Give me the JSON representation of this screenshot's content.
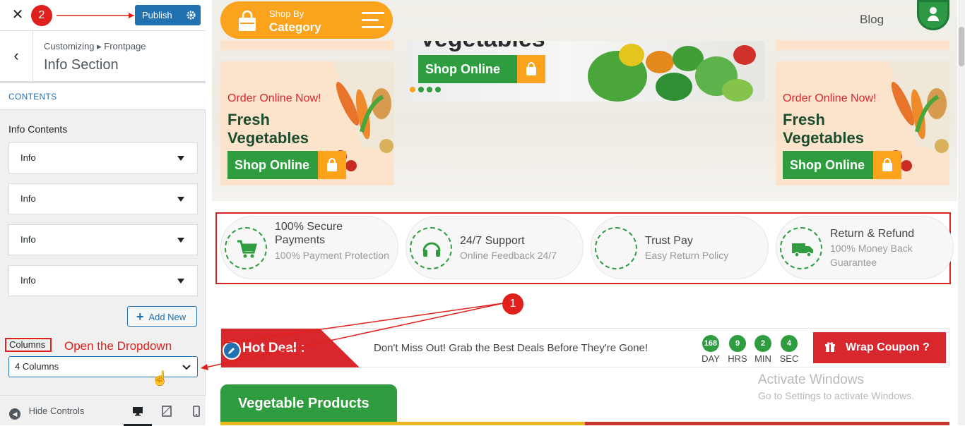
{
  "annotations": {
    "step1": "1",
    "step2": "2",
    "hint": "Open the Dropdown"
  },
  "customizer": {
    "publish_label": "Publish",
    "breadcrumb": "Customizing ▸ Frontpage",
    "section_title": "Info Section",
    "contents_heading": "CONTENTS",
    "info_contents_label": "Info Contents",
    "info_items": [
      "Info",
      "Info",
      "Info",
      "Info"
    ],
    "add_new_label": "Add New",
    "columns_label": "Columns",
    "columns_value": "4 Columns",
    "hide_controls_label": "Hide Controls"
  },
  "site": {
    "shop_by_small": "Shop By",
    "shop_by_big": "Category",
    "nav_blog": "Blog",
    "banner_title": "Vegetables",
    "promo_order": "Order Online Now!",
    "promo_title": "Fresh Vegetables",
    "shop_online": "Shop Online",
    "features": [
      {
        "title": "100% Secure Payments",
        "subtitle": "100% Payment Protection",
        "icon": "cart-icon"
      },
      {
        "title": "24/7 Support",
        "subtitle": "Online Feedback 24/7",
        "icon": "headphones-icon"
      },
      {
        "title": "Trust Pay",
        "subtitle": "Easy Return Policy",
        "icon": "blank-icon"
      },
      {
        "title": "Return & Refund",
        "subtitle": "100% Money Back Guarantee",
        "icon": "truck-icon"
      }
    ],
    "deal": {
      "label": "Hot Deal :",
      "message": "Don't Miss Out! Grab the Best Deals Before They're Gone!",
      "countdown": [
        {
          "value": "168",
          "unit": "DAY"
        },
        {
          "value": "9",
          "unit": "HRS"
        },
        {
          "value": "2",
          "unit": "MIN"
        },
        {
          "value": "4",
          "unit": "SEC"
        }
      ],
      "coupon_label": "Wrap Coupon ?"
    },
    "products_tab": "Vegetable Products"
  },
  "watermark": {
    "line1": "Activate Windows",
    "line2": "Go to Settings to activate Windows."
  },
  "colors": {
    "accent_blue": "#2271b1",
    "brand_green": "#2e9c3f",
    "brand_orange": "#fba31c",
    "brand_red": "#d9272e",
    "annotation_red": "#e0201c"
  }
}
